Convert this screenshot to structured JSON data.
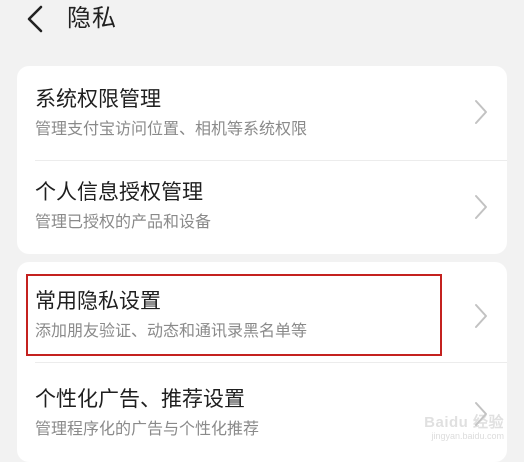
{
  "header": {
    "back_icon": "chevron-left-icon",
    "title": "隐私"
  },
  "groups": [
    {
      "items": [
        {
          "title": "系统权限管理",
          "subtitle": "管理支付宝访问位置、相机等系统权限"
        },
        {
          "title": "个人信息授权管理",
          "subtitle": "管理已授权的产品和设备"
        }
      ]
    },
    {
      "items": [
        {
          "title": "常用隐私设置",
          "subtitle": "添加朋友验证、动态和通讯录黑名单等",
          "highlighted": true
        },
        {
          "title": "个性化广告、推荐设置",
          "subtitle": "管理程序化的广告与个性化推荐"
        }
      ]
    }
  ],
  "watermark": {
    "line1": "Baidu 经验",
    "line2": "jingyan.baidu.com"
  },
  "colors": {
    "background": "#f2f2f2",
    "card": "#ffffff",
    "title_text": "#1f1f1f",
    "subtitle_text": "#8a8a8a",
    "chevron": "#c2c2c2",
    "highlight_border": "#c4211f"
  }
}
